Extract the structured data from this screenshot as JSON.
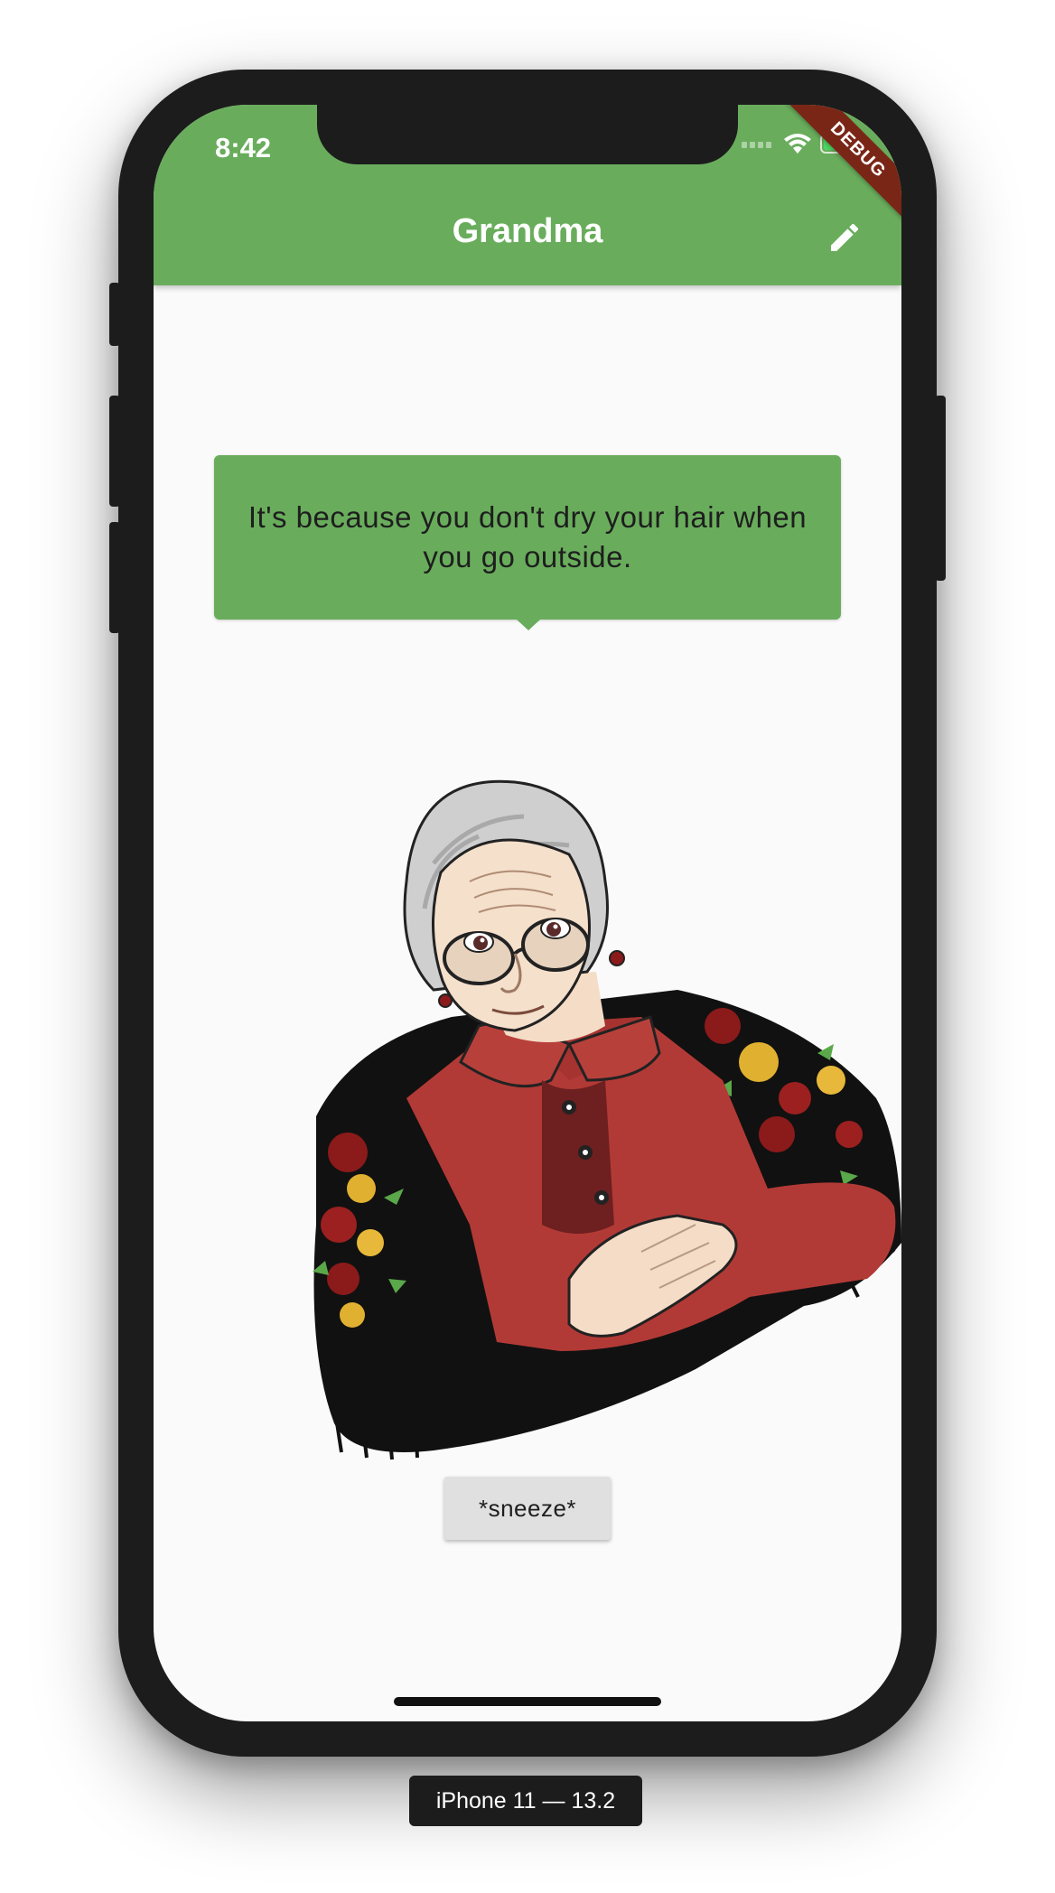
{
  "status_bar": {
    "time": "8:42"
  },
  "app_bar": {
    "title": "Grandma",
    "edit_icon": "pencil-icon",
    "color": "#69ad5c"
  },
  "debug_banner": "DEBUG",
  "speech_bubble": {
    "text": "It's because you don't dry your hair when you go outside."
  },
  "action_button": {
    "label": "*sneeze*"
  },
  "simulator_label": "iPhone 11 — 13.2"
}
